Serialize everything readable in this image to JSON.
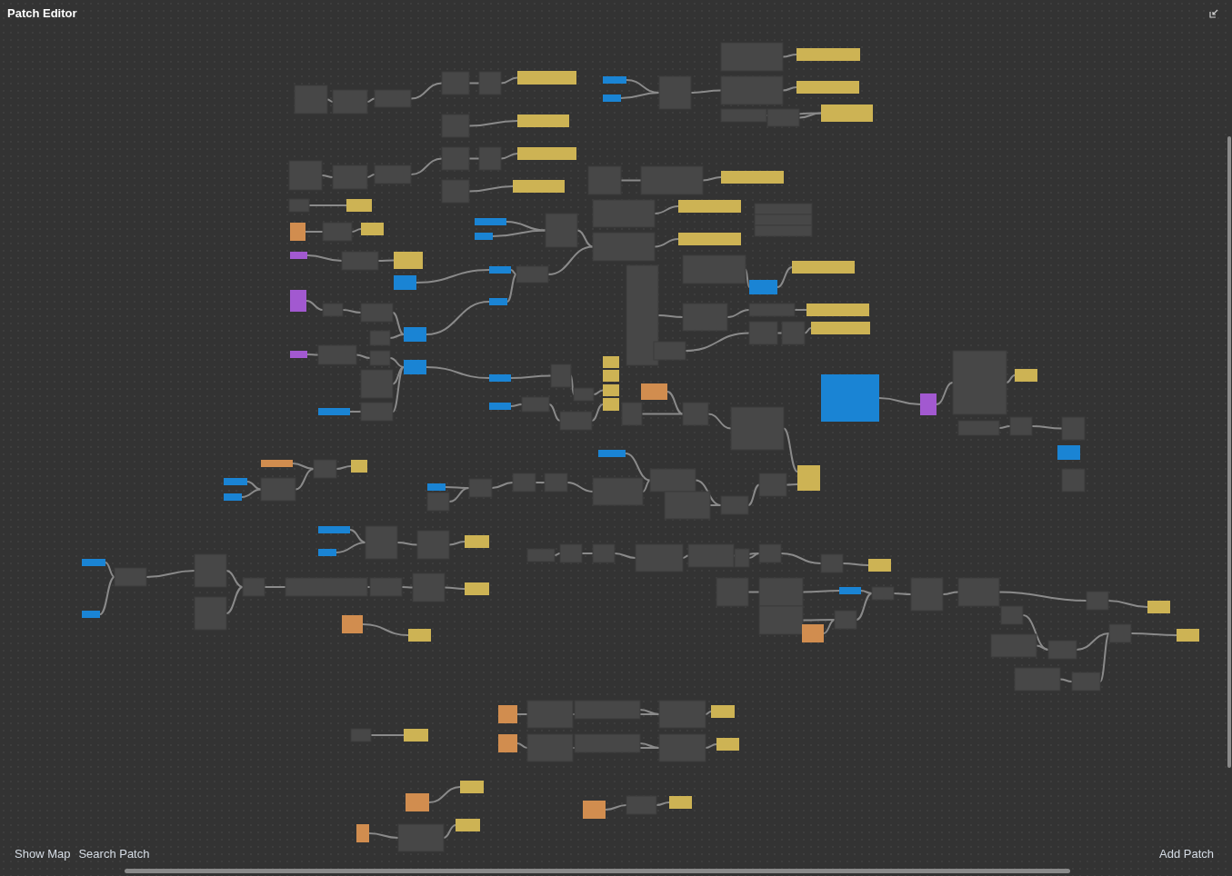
{
  "window": {
    "title": "Patch Editor"
  },
  "footer": {
    "left_buttons": [
      "Show Map",
      "Search Patch"
    ],
    "right_buttons": [
      "Add Patch"
    ]
  }
}
